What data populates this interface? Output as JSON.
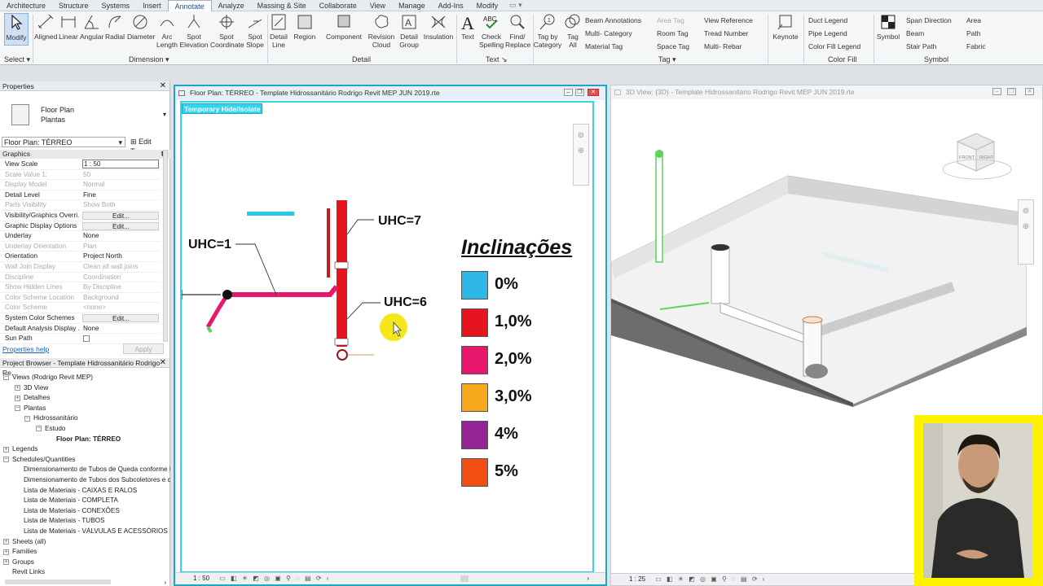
{
  "ribbon": {
    "tabs": [
      "Architecture",
      "Structure",
      "Systems",
      "Insert",
      "Annotate",
      "Analyze",
      "Massing & Site",
      "Collaborate",
      "View",
      "Manage",
      "Add-Ins",
      "Modify"
    ],
    "active_tab": "Annotate",
    "tab_extra": "▭ ▾",
    "tools": {
      "modify": "Modify",
      "aligned": "Aligned",
      "linear": "Linear",
      "angular": "Angular",
      "radial": "Radial",
      "diameter": "Diameter",
      "arc_length": "Arc\nLength",
      "spot_elevation": "Spot\nElevation",
      "spot_coordinate": "Spot\nCoordinate",
      "spot_slope": "Spot\nSlope",
      "detail_line": "Detail\nLine",
      "region": "Region",
      "component": "Component",
      "revision_cloud": "Revision\nCloud",
      "detail_group": "Detail\nGroup",
      "insulation": "Insulation",
      "text": "Text",
      "check_spelling": "Check\nSpelling",
      "find_replace": "Find/\nReplace",
      "tag_by_category": "Tag by\nCategory",
      "tag_all": "Tag\nAll",
      "keynote": "Keynote",
      "symbol": "Symbol"
    },
    "stack_tag": [
      "Beam  Annotations",
      "Multi- Category",
      "Material  Tag"
    ],
    "stack_tag2": [
      "Area  Tag",
      "Room  Tag",
      "Space  Tag"
    ],
    "stack_tag3": [
      "View  Reference",
      "Tread  Number",
      "Multi- Rebar"
    ],
    "stack_legend": [
      "Duct  Legend",
      "Pipe  Legend",
      "Color Fill  Legend"
    ],
    "stack_symbol1": [
      "Span  Direction",
      "Beam",
      "Stair Path"
    ],
    "stack_symbol2": [
      "Area",
      "Path",
      "Fabric"
    ],
    "group_labels": {
      "select": "Select",
      "dimension": "Dimension",
      "detail": "Detail",
      "text": "Text",
      "tag": "Tag",
      "color_fill": "Color Fill",
      "symbol": "Symbol"
    }
  },
  "properties": {
    "title": "Properties",
    "type_line1": "Floor Plan",
    "type_line2": "Plantas",
    "instance_selector": "Floor Plan: TÉRREO",
    "edit_type": "Edit Type",
    "group": "Graphics",
    "rows": [
      {
        "k": "View Scale",
        "v": "1 : 50"
      },
      {
        "k": "Scale Value    1:",
        "v": "50"
      },
      {
        "k": "Display Model",
        "v": "Normal"
      },
      {
        "k": "Detail Level",
        "v": "Fine"
      },
      {
        "k": "Parts Visibility",
        "v": "Show Both"
      },
      {
        "k": "Visibility/Graphics Overri...",
        "v": "Edit..."
      },
      {
        "k": "Graphic Display Options",
        "v": "Edit..."
      },
      {
        "k": "Underlay",
        "v": "None"
      },
      {
        "k": "Underlay Orientation",
        "v": "Plan"
      },
      {
        "k": "Orientation",
        "v": "Project North"
      },
      {
        "k": "Wall Join Display",
        "v": "Clean all wall joins"
      },
      {
        "k": "Discipline",
        "v": "Coordination"
      },
      {
        "k": "Show Hidden Lines",
        "v": "By Discipline"
      },
      {
        "k": "Color Scheme Location",
        "v": "Background"
      },
      {
        "k": "Color Scheme",
        "v": "<none>"
      },
      {
        "k": "System Color Schemes",
        "v": "Edit..."
      },
      {
        "k": "Default Analysis Display ...",
        "v": "None"
      },
      {
        "k": "Sun Path",
        "v": ""
      }
    ],
    "help": "Properties help",
    "apply": "Apply"
  },
  "browser": {
    "title": "Project Browser - Template Hidrossanitário Rodrigo Re...",
    "nodes": [
      {
        "t": "Views (Rodrigo Revit MEP)",
        "lvl": 0,
        "tg": "−"
      },
      {
        "t": "3D View",
        "lvl": 1,
        "tg": "+"
      },
      {
        "t": "Detalhes",
        "lvl": 1,
        "tg": "+"
      },
      {
        "t": "Plantas",
        "lvl": 1,
        "tg": "−"
      },
      {
        "t": "Hidrossanitário",
        "lvl": 2,
        "tg": "−"
      },
      {
        "t": "Estudo",
        "lvl": 3,
        "tg": "−"
      },
      {
        "t": "Floor Plan: TÉRREO",
        "lvl": 4,
        "tg": "",
        "bold": true
      },
      {
        "t": "Legends",
        "lvl": 0,
        "tg": "+"
      },
      {
        "t": "Schedules/Quantities",
        "lvl": 0,
        "tg": "−"
      },
      {
        "t": "Dimensionamento de Tubos de Queda conforme N",
        "lvl": 1,
        "tg": ""
      },
      {
        "t": "Dimensionamento de Tubos dos Subcoletores e col",
        "lvl": 1,
        "tg": ""
      },
      {
        "t": "Lista de Materiais - CAIXAS E RALOS",
        "lvl": 1,
        "tg": ""
      },
      {
        "t": "Lista de Materiais - COMPLETA",
        "lvl": 1,
        "tg": ""
      },
      {
        "t": "Lista de Materiais - CONEXÕES",
        "lvl": 1,
        "tg": ""
      },
      {
        "t": "Lista de Materiais - TUBOS",
        "lvl": 1,
        "tg": ""
      },
      {
        "t": "Lista de Materiais - VÁLVULAS E ACESSÓRIOS",
        "lvl": 1,
        "tg": ""
      },
      {
        "t": "Sheets (all)",
        "lvl": 0,
        "tg": "+"
      },
      {
        "t": "Families",
        "lvl": 0,
        "tg": "+"
      },
      {
        "t": "Groups",
        "lvl": 0,
        "tg": "+"
      },
      {
        "t": "Revit Links",
        "lvl": 0,
        "tg": ""
      }
    ]
  },
  "view_plan": {
    "title": "Floor Plan: TÉRREO - Template Hidrossanitário Rodrigo Revit MEP JUN 2019.rte",
    "temp_hide": "Temporary Hide/Isolate",
    "scale": "1 : 50",
    "uhc_labels": [
      "UHC=1",
      "UHC=7",
      "UHC=6"
    ],
    "legend_title": "Inclinações",
    "legend": [
      {
        "label": "0%",
        "color": "#2fb7e8"
      },
      {
        "label": "1,0%",
        "color": "#e6141e"
      },
      {
        "label": "2,0%",
        "color": "#e8166d"
      },
      {
        "label": "3,0%",
        "color": "#f7a81c"
      },
      {
        "label": "4%",
        "color": "#952496"
      },
      {
        "label": "5%",
        "color": "#f04e13"
      }
    ]
  },
  "view_3d": {
    "title": "3D View: {3D} - Template Hidrossanitário Rodrigo Revit MEP JUN 2019.rte",
    "scale": "1 : 25",
    "viewcube_front": "FRONT",
    "viewcube_right": "RIGHT"
  },
  "colors": {
    "accent": "#1aa7c8",
    "selection": "#35d3ef",
    "active_tab": "#1b4e8c"
  }
}
